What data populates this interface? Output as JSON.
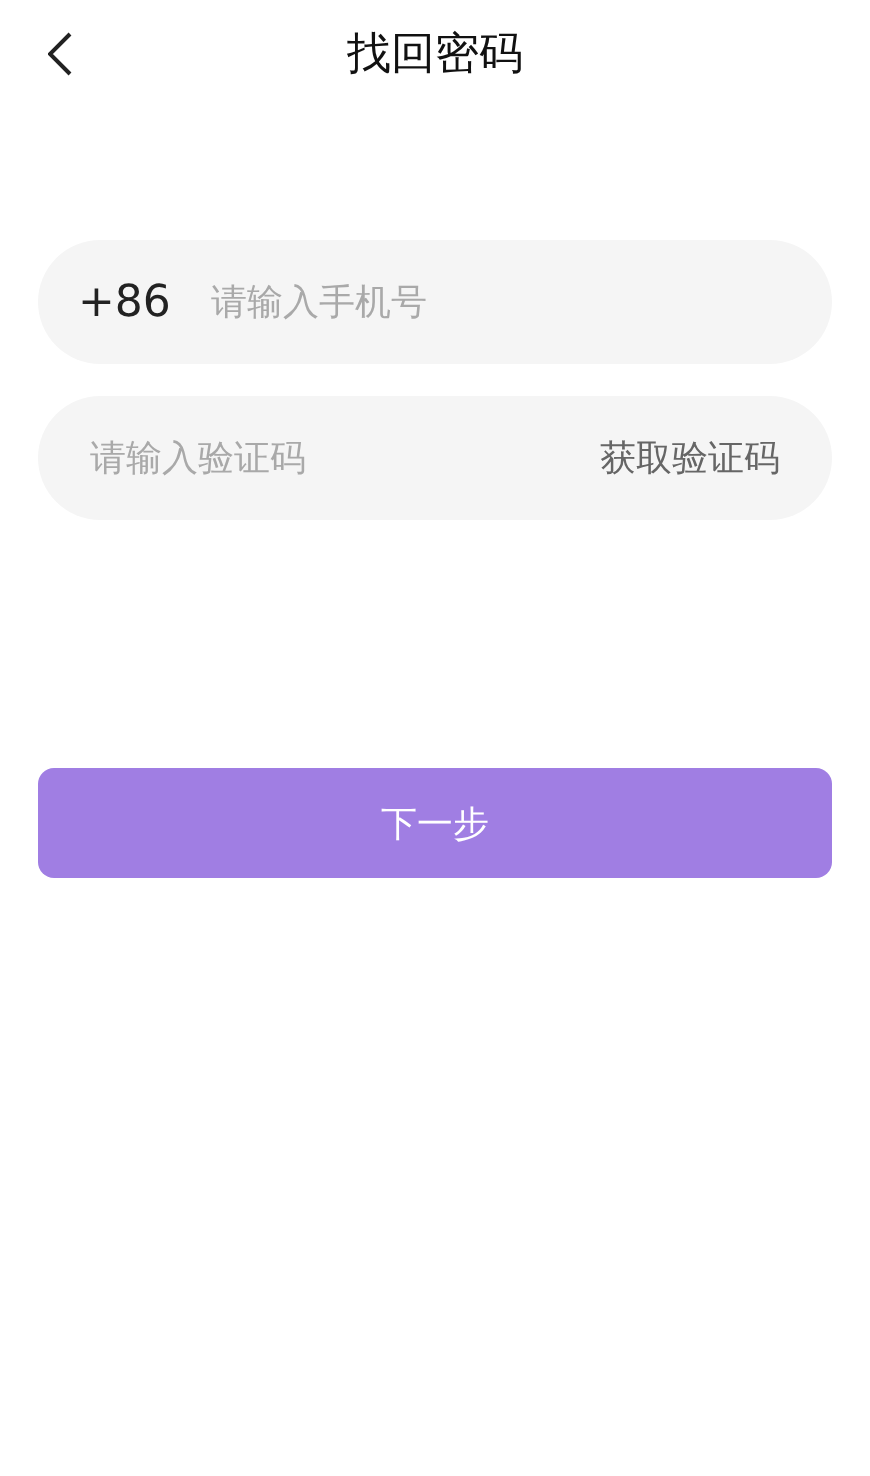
{
  "header": {
    "title": "找回密码"
  },
  "phone_field": {
    "prefix": "+86",
    "placeholder": "请输入手机号"
  },
  "code_field": {
    "placeholder": "请输入验证码",
    "action": "获取验证码"
  },
  "button": {
    "label": "下一步"
  }
}
